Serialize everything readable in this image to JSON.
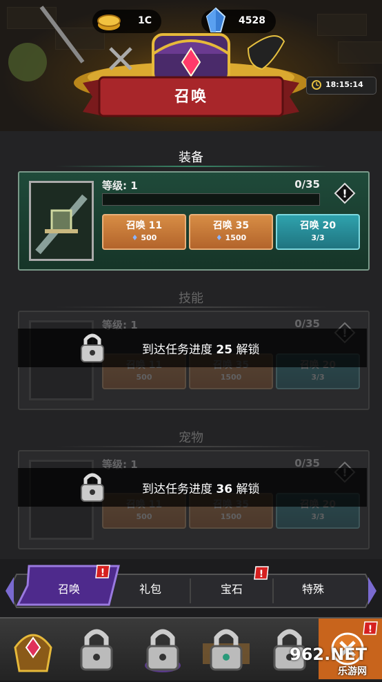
{
  "header": {
    "title": "召唤",
    "gold_value": "1C",
    "crystal_value": "4528",
    "timer": "18:15:14"
  },
  "sections": [
    {
      "title": "装备",
      "level_label": "等级: ",
      "level_value": "1",
      "progress": "0/35",
      "locked": false,
      "buttons": [
        {
          "label": "召唤 11",
          "sub": "500",
          "style": "orange"
        },
        {
          "label": "召唤 35",
          "sub": "1500",
          "style": "orange"
        },
        {
          "label": "召唤 20",
          "sub": "3/3",
          "style": "teal"
        }
      ]
    },
    {
      "title": "技能",
      "level_label": "等级: ",
      "level_value": "1",
      "progress": "0/35",
      "locked": true,
      "lock_prefix": "到达任务进度 ",
      "lock_value": "25",
      "lock_suffix": " 解锁",
      "buttons": [
        {
          "label": "召唤 11",
          "sub": "500"
        },
        {
          "label": "召唤 35",
          "sub": "1500"
        },
        {
          "label": "召唤 20",
          "sub": "3/3"
        }
      ]
    },
    {
      "title": "宠物",
      "level_label": "等级: ",
      "level_value": "1",
      "progress": "0/35",
      "locked": true,
      "lock_prefix": "到达任务进度 ",
      "lock_value": "36",
      "lock_suffix": " 解锁",
      "buttons": [
        {
          "label": "召唤 11",
          "sub": "500"
        },
        {
          "label": "召唤 35",
          "sub": "1500"
        },
        {
          "label": "召唤 20",
          "sub": "3/3"
        }
      ]
    }
  ],
  "tabs": [
    {
      "label": "召唤",
      "active": true,
      "badge": true
    },
    {
      "label": "礼包",
      "active": false,
      "badge": false
    },
    {
      "label": "宝石",
      "active": false,
      "badge": true
    },
    {
      "label": "特殊",
      "active": false,
      "badge": false
    }
  ],
  "bottom_nav": [
    {
      "icon": "hero-helmet-icon",
      "locked": false
    },
    {
      "icon": "lock-icon",
      "locked": true
    },
    {
      "icon": "lock-icon",
      "locked": true
    },
    {
      "icon": "lock-icon",
      "locked": true
    },
    {
      "icon": "lock-icon",
      "locked": true
    },
    {
      "icon": "close-icon",
      "locked": false
    }
  ],
  "watermark": {
    "main": "962.NET",
    "sub": "乐游网"
  },
  "colors": {
    "accent_purple": "#5a2fa0",
    "title_ribbon": "#a8262a",
    "button_orange": "#c0783a",
    "button_teal": "#2a8e99",
    "card_active": "#1f4a3a",
    "badge_red": "#d62020"
  }
}
